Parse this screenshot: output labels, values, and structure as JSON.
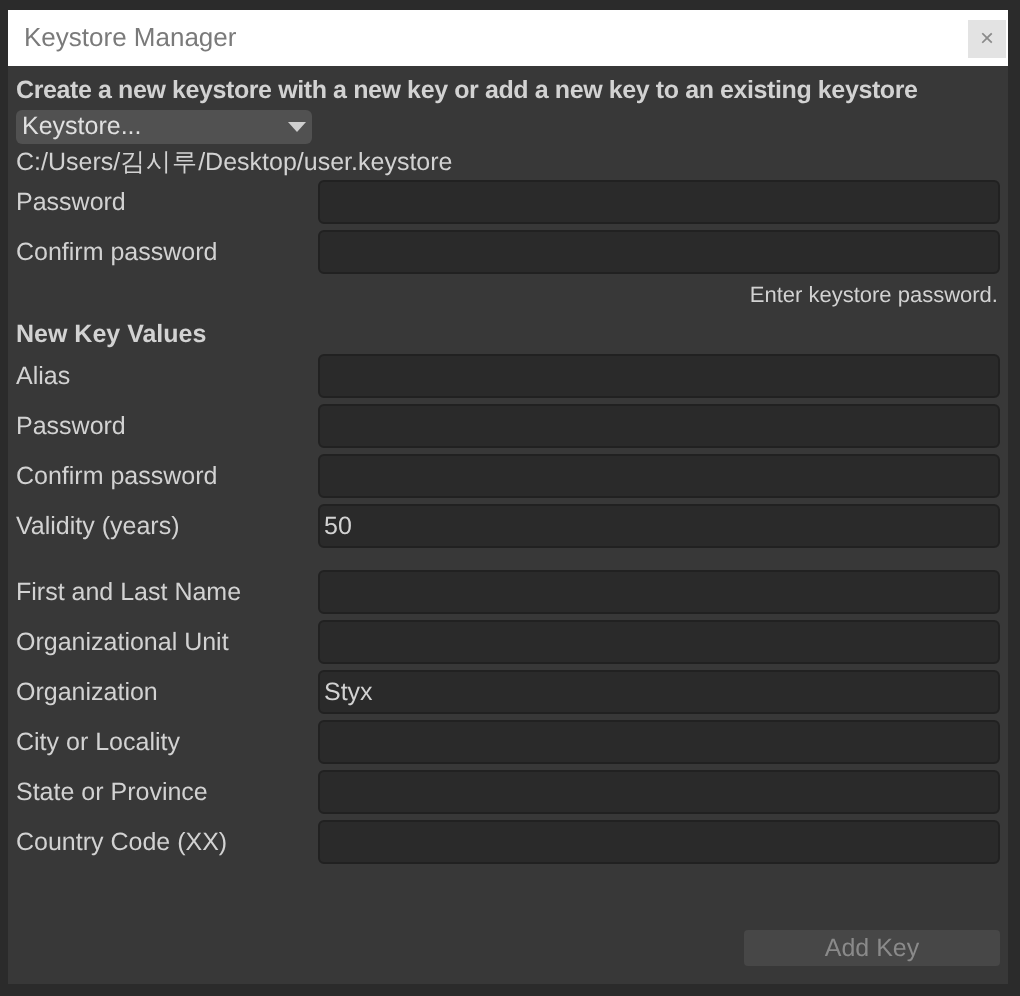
{
  "window": {
    "title": "Keystore Manager",
    "close": "×"
  },
  "intro": "Create a new keystore with a new key or add a new key to an existing keystore",
  "keystore_dropdown": {
    "value": "Keystore..."
  },
  "keystore_path": "C:/Users/김시루/Desktop/user.keystore",
  "keystore_fields": [
    {
      "label": "Password"
    },
    {
      "label": "Confirm password"
    }
  ],
  "hint": "Enter keystore password.",
  "new_key_values": {
    "heading": "New Key Values",
    "fields": [
      {
        "label": "Alias"
      },
      {
        "label": "Password"
      },
      {
        "label": "Confirm password"
      },
      {
        "label": "Validity (years)",
        "value": "50"
      }
    ]
  },
  "identity_fields": [
    {
      "label": "First and Last Name"
    },
    {
      "label": "Organizational Unit"
    },
    {
      "label": "Organization",
      "value": "Styx"
    },
    {
      "label": "City or Locality"
    },
    {
      "label": "State or Province"
    },
    {
      "label": "Country Code (XX)"
    }
  ],
  "add_key_button": {
    "label": "Add Key",
    "disabled": true
  }
}
